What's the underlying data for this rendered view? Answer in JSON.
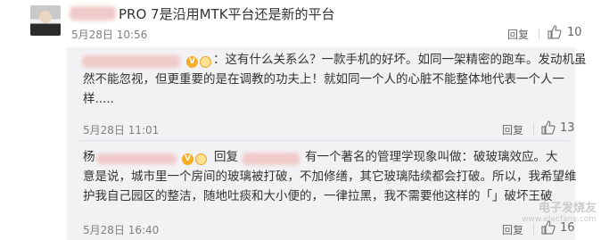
{
  "comment_main": {
    "text": "PRO 7是沿用MTK平台还是新的平台",
    "date": "5月28日 10:56",
    "reply_label": "回复",
    "like_count": "10"
  },
  "reply1": {
    "v_badge": "V",
    "text": "：这有什么关系么？一款手机的好坏。如同一架精密的跑车。发动机虽然不能忽视，但更重要的是在调教的功夫上！就如同一个人的心脏不能整体地代表一个人一样.....",
    "line1": "：这有什么关系么？一款手机的好坏。如同一架精密的跑车。发动机虽",
    "line2": "然不能忽视，但更重要的是在调教的功夫上！就如同一个人的心脏不能整体地代表一个人一",
    "line3": "样.....",
    "date": "5月28日 11:01",
    "reply_label": "回复",
    "like_count": "13"
  },
  "reply2": {
    "name_initial": "杨",
    "v_badge": "V",
    "reply_prefix": "回复",
    "line1": "有一个著名的管理学现象叫做：破玻璃效应。大",
    "line2": "意是说，城市里一个房间的玻璃被打破，不加修缮，其它玻璃陆续都会打破。所以，我希望维",
    "line3": "护我自己园区的整洁，随地吐痰和大小便的，一律拉黑，我不需要他这样的「」破坏王破",
    "date": "5月28日 16:40",
    "reply_label": "回复",
    "like_count": "16"
  },
  "watermark": {
    "site": "电子发烧友",
    "url": "www.elecfans.com"
  },
  "colors": {
    "reply_bg": "#f2f2f5",
    "badge": "#f6ad25"
  }
}
